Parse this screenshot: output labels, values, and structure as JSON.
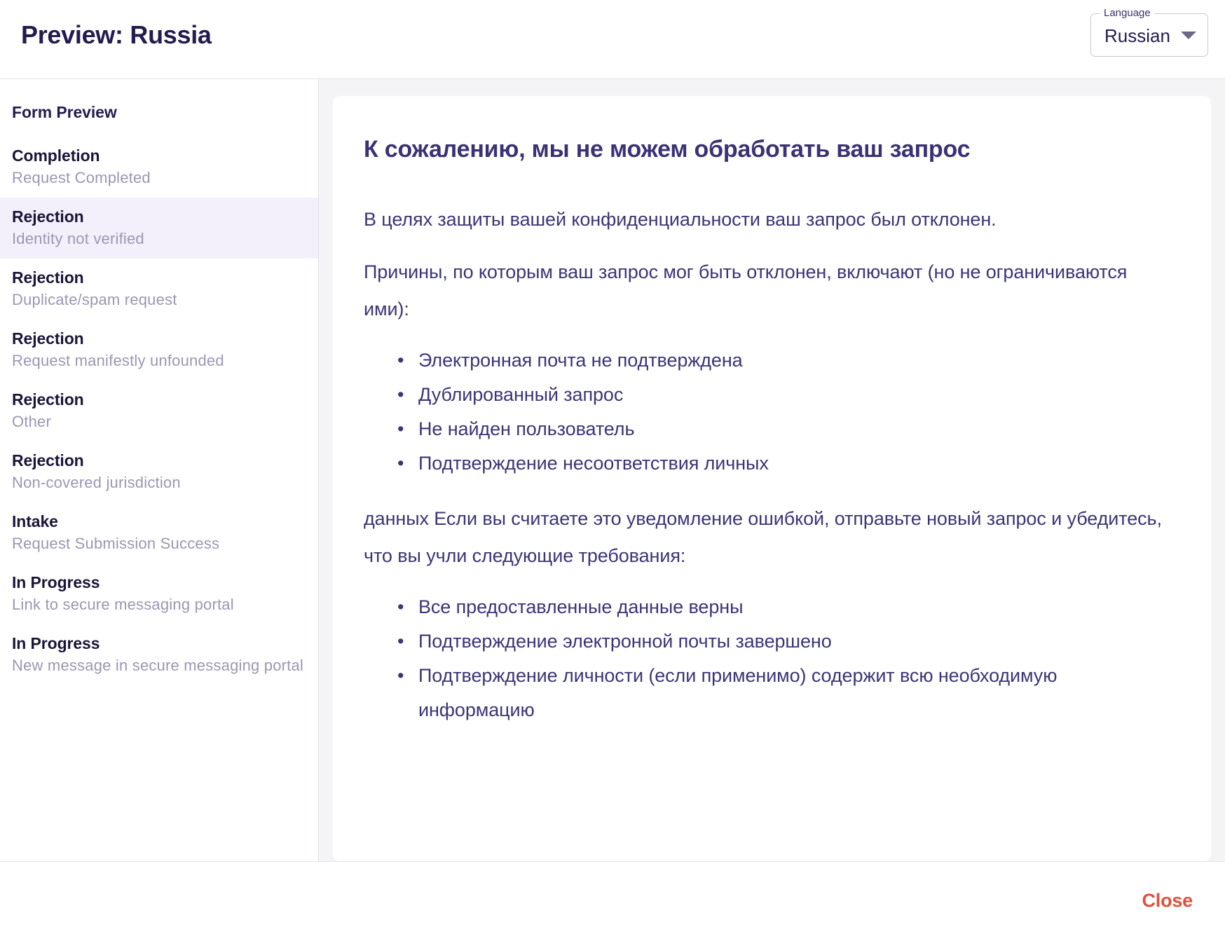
{
  "header": {
    "title": "Preview: Russia",
    "language_label": "Language",
    "language_value": "Russian",
    "chevron_icon": "chevron-down-icon"
  },
  "sidebar": {
    "heading": "Form Preview",
    "items": [
      {
        "title": "Completion",
        "subtitle": "Request Completed",
        "selected": false
      },
      {
        "title": "Rejection",
        "subtitle": "Identity not verified",
        "selected": true
      },
      {
        "title": "Rejection",
        "subtitle": "Duplicate/spam request",
        "selected": false
      },
      {
        "title": "Rejection",
        "subtitle": "Request manifestly unfounded",
        "selected": false
      },
      {
        "title": "Rejection",
        "subtitle": "Other",
        "selected": false
      },
      {
        "title": "Rejection",
        "subtitle": "Non-covered jurisdiction",
        "selected": false
      },
      {
        "title": "Intake",
        "subtitle": "Request Submission Success",
        "selected": false
      },
      {
        "title": "In Progress",
        "subtitle": "Link to secure messaging portal",
        "selected": false
      },
      {
        "title": "In Progress",
        "subtitle": "New message in secure messaging portal",
        "selected": false
      }
    ]
  },
  "content": {
    "heading": "К сожалению, мы не можем обработать ваш запрос",
    "paragraph_1": "В целях защиты вашей конфиденциальности ваш запрос был отклонен.",
    "paragraph_2": "Причины, по которым ваш запрос мог быть отклонен, включают (но не ограничиваются ими):",
    "list_1": [
      "Электронная почта не подтверждена",
      "Дублированный запрос",
      "Не найден пользователь",
      "Подтверждение несоответствия личных"
    ],
    "paragraph_3": "данных Если вы считаете это уведомление ошибкой, отправьте новый запрос и убедитесь, что вы учли следующие требования:",
    "list_2": [
      "Все предоставленные данные верны",
      "Подтверждение электронной почты завершено",
      "Подтверждение личности (если применимо) содержит всю необходимую информацию"
    ]
  },
  "footer": {
    "close_label": "Close"
  },
  "colors": {
    "title": "#241c4f",
    "heading": "#3b3275",
    "body_text": "#3b3577",
    "sidebar_subtitle": "#9a98b3",
    "selected_row": "#f3f0fb",
    "main_background": "#f4f4f6",
    "close_accent": "#e0503c"
  }
}
